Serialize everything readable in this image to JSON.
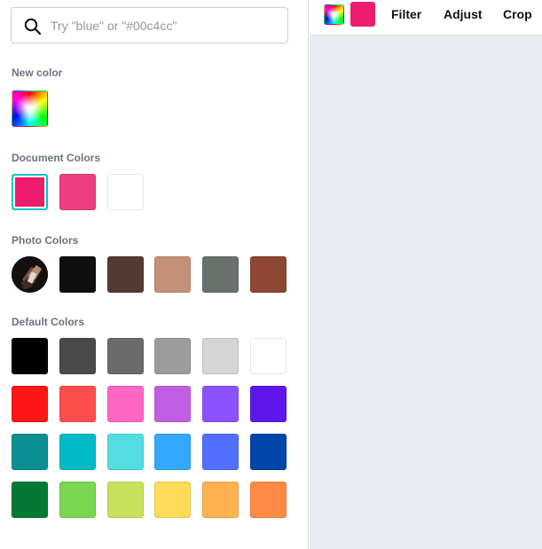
{
  "search": {
    "placeholder": "Try \"blue\" or \"#00c4cc\""
  },
  "sections": {
    "new_color": "New color",
    "document_colors": "Document Colors",
    "photo_colors": "Photo Colors",
    "default_colors": "Default Colors"
  },
  "document_colors": [
    "#ed1c6f",
    "#ee3e80",
    "#ffffff"
  ],
  "selected_document_color": "#ed1c6f",
  "photo_colors": [
    "#0f0f0f",
    "#553a31",
    "#c49078",
    "#6a716d",
    "#8e4733"
  ],
  "default_colors": [
    [
      "#000000",
      "#4a4a4a",
      "#6b6b6b",
      "#9c9c9c",
      "#d5d5d5",
      "#ffffff"
    ],
    [
      "#ff1616",
      "#ff4d4d",
      "#ff66c4",
      "#c25ee3",
      "#8c52ff",
      "#5e17eb"
    ],
    [
      "#0b8f93",
      "#00bbc5",
      "#52dde2",
      "#33a8ff",
      "#5170ff",
      "#0046aa"
    ],
    [
      "#047935",
      "#7ad550",
      "#c8e15c",
      "#ffdb57",
      "#ffb24f",
      "#ff8a43"
    ]
  ],
  "toolbar": {
    "current_color": "#ed1c6f",
    "filter_label": "Filter",
    "adjust_label": "Adjust",
    "crop_label": "Crop"
  },
  "colors": {
    "accent": "#00c4cc",
    "canvas_bg": "#e8ebef"
  }
}
